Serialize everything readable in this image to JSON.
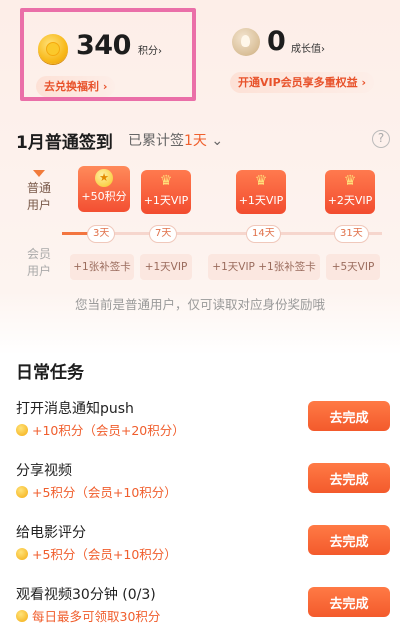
{
  "points": {
    "value": "340",
    "unit": "积分›",
    "exchange": "去兑换福利 ›"
  },
  "growth": {
    "value": "0",
    "unit": "成长值›",
    "vip_link": "开通VIP会员享多重权益 ›"
  },
  "sign": {
    "title": "1月普通签到",
    "sub_prefix": "已累计签",
    "sub_days": "1天",
    "sub_chevron": "⌄",
    "help": "?",
    "row_normal": "普通\n用户",
    "row_member": "会员\n用户",
    "normal_rewards": [
      "+50积分",
      "+1天VIP",
      "+1天VIP",
      "+2天VIP"
    ],
    "days": [
      "3天",
      "7天",
      "14天",
      "31天"
    ],
    "member_rewards": [
      "+1张补签卡",
      "+1天VIP",
      "+1天VIP +1张补签卡",
      "+5天VIP"
    ],
    "note": "您当前是普通用户，仅可读取对应身份奖励哦"
  },
  "tasks": {
    "title": "日常任务",
    "items": [
      {
        "name": "打开消息通知push",
        "reward": "+10积分（会员+20积分）",
        "button": "去完成"
      },
      {
        "name": "分享视频",
        "reward": "+5积分（会员+10积分）",
        "button": "去完成"
      },
      {
        "name": "给电影评分",
        "reward": "+5积分（会员+10积分）",
        "button": "去完成"
      },
      {
        "name": "观看视频30分钟 (0/3)",
        "reward": "每日最多可领取30积分",
        "button": "去完成"
      }
    ]
  },
  "colors": {
    "accent": "#f35a2c",
    "highlight_border": "#ea6fa8"
  }
}
